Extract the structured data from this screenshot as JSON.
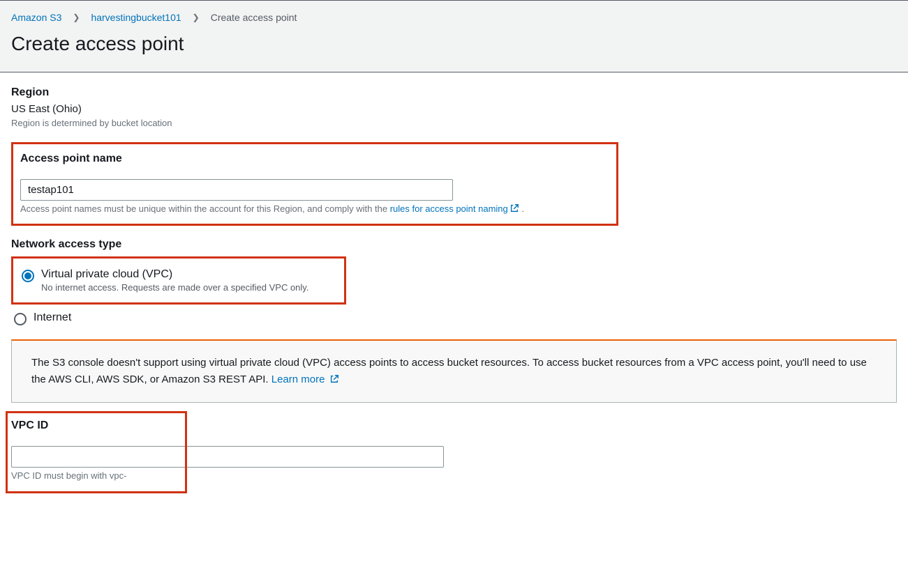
{
  "breadcrumb": {
    "root": "Amazon S3",
    "bucket": "harvestingbucket101",
    "current": "Create access point"
  },
  "pageTitle": "Create access point",
  "region": {
    "label": "Region",
    "value": "US East (Ohio)",
    "helper": "Region is determined by bucket location"
  },
  "accessPointName": {
    "label": "Access point name",
    "value": "testap101",
    "helper_prefix": "Access point names must be unique within the account for this Region, and comply with the ",
    "helper_link": "rules for access point naming",
    "helper_suffix": " ."
  },
  "networkAccessType": {
    "label": "Network access type",
    "options": {
      "vpc": {
        "label": "Virtual private cloud (VPC)",
        "sub": "No internet access. Requests are made over a specified VPC only.",
        "selected": true
      },
      "internet": {
        "label": "Internet",
        "selected": false
      }
    }
  },
  "alert": {
    "text": "The S3 console doesn't support using virtual private cloud (VPC) access points to access bucket resources. To access bucket resources from a VPC access point, you'll need to use the AWS CLI, AWS SDK, or Amazon S3 REST API. ",
    "link": "Learn more"
  },
  "vpcId": {
    "label": "VPC ID",
    "value": "",
    "placeholder": "",
    "helper": "VPC ID must begin with vpc-"
  },
  "colors": {
    "link": "#0073bb",
    "highlight": "#d13212",
    "alertAccent": "#eb5f07"
  }
}
